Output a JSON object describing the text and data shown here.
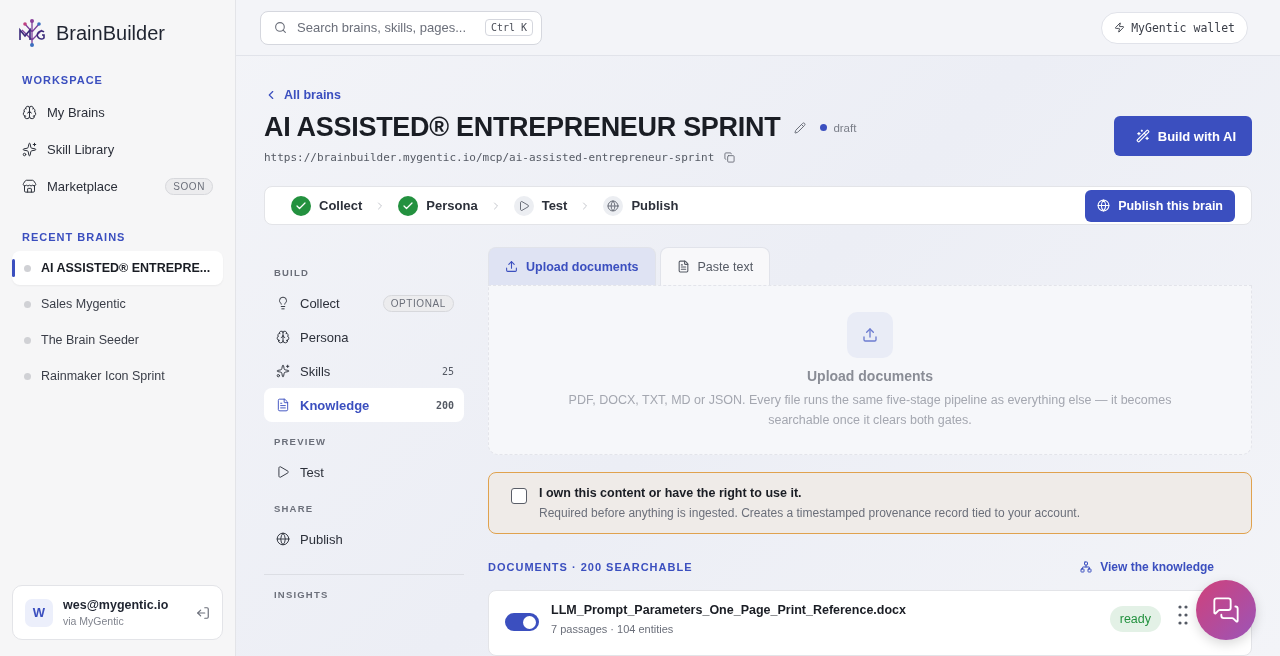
{
  "sidebar": {
    "brand": "BrainBuilder",
    "sections": [
      {
        "title": "WORKSPACE",
        "items": [
          {
            "label": "My Brains"
          },
          {
            "label": "Skill Library"
          },
          {
            "label": "Marketplace",
            "badge": "SOON"
          }
        ]
      }
    ],
    "recent": {
      "title": "RECENT BRAINS",
      "items": [
        {
          "label": "AI ASSISTED® ENTREPRE...",
          "selected": true
        },
        {
          "label": "Sales Mygentic",
          "selected": false
        },
        {
          "label": "The Brain Seeder",
          "selected": false
        },
        {
          "label": "Rainmaker Icon Sprint",
          "selected": false
        }
      ]
    },
    "user": {
      "avatar": "W",
      "email": "wes@mygentic.io",
      "provider": "via MyGentic"
    }
  },
  "topbar": {
    "search": {
      "placeholder": "Search brains, skills, pages...",
      "shortcut": "Ctrl K"
    },
    "wallet": "MyGentic wallet"
  },
  "header": {
    "back": "All brains",
    "title": "AI ASSISTED® ENTREPRENEUR SPRINT",
    "status": "draft",
    "url": "https://brainbuilder.mygentic.io/mcp/ai-assisted-entrepreneur-sprint",
    "action": "Build with AI"
  },
  "stepper": {
    "steps": [
      {
        "label": "Collect",
        "done": true
      },
      {
        "label": "Persona",
        "done": true
      },
      {
        "label": "Test",
        "done": false
      },
      {
        "label": "Publish",
        "done": false
      }
    ],
    "action": "Publish this brain"
  },
  "subnav": [
    {
      "title": "BUILD",
      "items": [
        {
          "label": "Collect",
          "badge": "OPTIONAL",
          "selected": false
        },
        {
          "label": "Persona",
          "selected": false
        },
        {
          "label": "Skills",
          "count": "25",
          "selected": false
        },
        {
          "label": "Knowledge",
          "count": "200",
          "selected": true
        }
      ]
    },
    {
      "title": "PREVIEW",
      "items": [
        {
          "label": "Test",
          "selected": false
        }
      ]
    },
    {
      "title": "SHARE",
      "items": [
        {
          "label": "Publish",
          "selected": false
        }
      ]
    },
    {
      "title": "INSIGHTS"
    }
  ],
  "tabs": [
    {
      "label": "Upload documents",
      "selected": true
    },
    {
      "label": "Paste text",
      "selected": false
    }
  ],
  "dropzone": {
    "title": "Upload documents",
    "description": "PDF, DOCX, TXT, MD or JSON. Every file runs the same five-stage pipeline as everything else — it becomes searchable once it clears both gates."
  },
  "consent": {
    "checked": false,
    "title": "I own this content or have the right to use it.",
    "description": "Required before anything is ingested. Creates a timestamped provenance record tied to your account."
  },
  "documents": {
    "title": "DOCUMENTS · 200 SEARCHABLE",
    "link": "View the knowledge",
    "items": [
      {
        "on": true,
        "name": "LLM_Prompt_Parameters_One_Page_Print_Reference.docx",
        "meta": "7 passages · 104 entities",
        "status": "ready"
      }
    ]
  }
}
